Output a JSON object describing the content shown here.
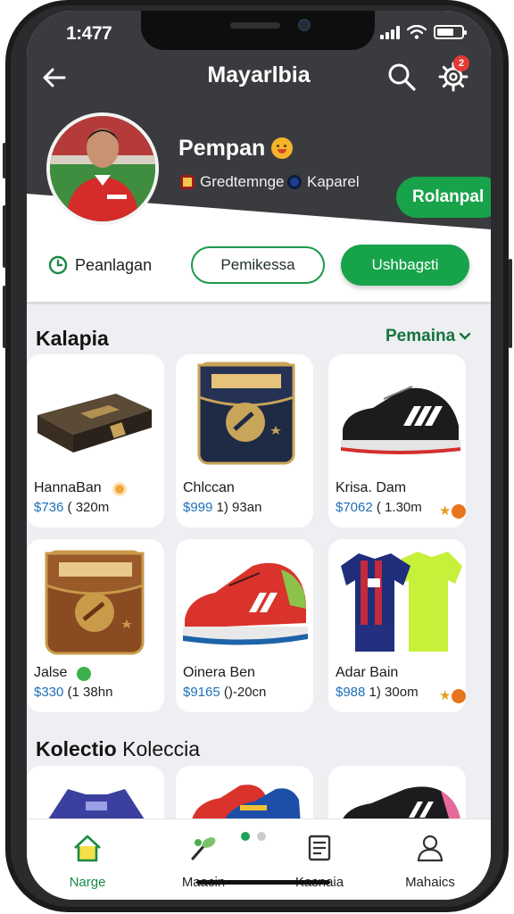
{
  "status_bar": {
    "time": "1:477"
  },
  "header": {
    "title": "Mayarlbia",
    "notification_count": "2",
    "icons": [
      "back-arrow-icon",
      "search-icon",
      "gear-icon"
    ]
  },
  "profile": {
    "name": "Pempan",
    "meta_left": "Gredtemnge",
    "meta_right": "Kaparel",
    "follow_label": "Rolanpal"
  },
  "actions": {
    "clock_label": "Peanlagan",
    "outline_label": "Pemikessa",
    "solid_label": "Ushbagɛti"
  },
  "section1": {
    "title": "Kalapia",
    "link": "Pemaina"
  },
  "products": [
    {
      "name": "HannaBan",
      "price": "$736",
      "price_rest": "( 320m"
    },
    {
      "name": "Chlccan",
      "price": "$999",
      "price_rest": "1) 93an"
    },
    {
      "name": "Krisa. Dam",
      "price": "$7062",
      "price_rest": "( 1.30m"
    },
    {
      "name": "Jalse",
      "price": "$330",
      "price_rest": "(1 38hn"
    },
    {
      "name": "Oinera Ben",
      "price": "$9165",
      "price_rest": "()-20cn"
    },
    {
      "name": "Adar Bain",
      "price": "$988",
      "price_rest": "1) 30om"
    }
  ],
  "section2": {
    "title": "Kolectio",
    "title_suffix": "Koleccia"
  },
  "bottom_nav": [
    {
      "label": "Narge"
    },
    {
      "label": "Maacin"
    },
    {
      "label": "Kasnaia"
    },
    {
      "label": "Mahaics"
    }
  ],
  "colors": {
    "accent": "#16a34a",
    "price": "#1e6fb8",
    "header": "#3a3b3e"
  }
}
